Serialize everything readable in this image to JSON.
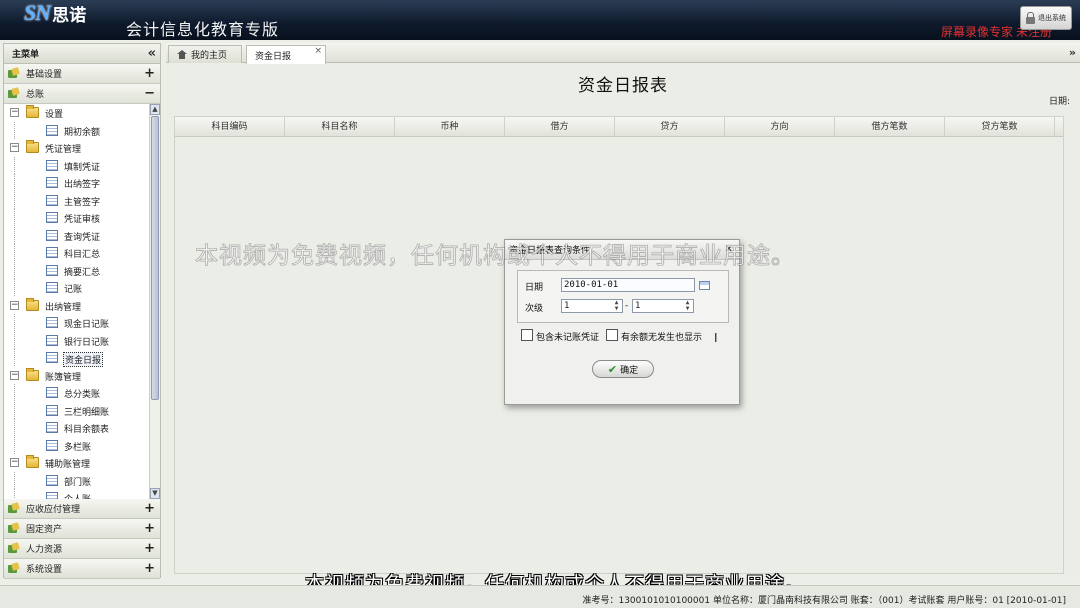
{
  "header": {
    "logo_text": "SN",
    "logo_cn": "思诺",
    "app_title": "会计信息化教育专版",
    "logout_label": "退出系统",
    "recorder_mark": "屏幕录像专家 未注册"
  },
  "sidebar": {
    "title": "主菜单",
    "groups_top": [
      {
        "label": "基础设置",
        "toggle": "+"
      },
      {
        "label": "总账",
        "toggle": "−"
      }
    ],
    "tree": [
      {
        "type": "folder",
        "label": "设置",
        "toggle": "−"
      },
      {
        "type": "leaf",
        "label": "期初余额"
      },
      {
        "type": "folder",
        "label": "凭证管理",
        "toggle": "−"
      },
      {
        "type": "leaf",
        "label": "填制凭证"
      },
      {
        "type": "leaf",
        "label": "出纳签字"
      },
      {
        "type": "leaf",
        "label": "主管签字"
      },
      {
        "type": "leaf",
        "label": "凭证审核"
      },
      {
        "type": "leaf",
        "label": "查询凭证"
      },
      {
        "type": "leaf",
        "label": "科目汇总"
      },
      {
        "type": "leaf",
        "label": "摘要汇总"
      },
      {
        "type": "leaf",
        "label": "记账"
      },
      {
        "type": "folder",
        "label": "出纳管理",
        "toggle": "−"
      },
      {
        "type": "leaf",
        "label": "现金日记账"
      },
      {
        "type": "leaf",
        "label": "银行日记账"
      },
      {
        "type": "leaf",
        "label": "资金日报",
        "selected": true
      },
      {
        "type": "folder",
        "label": "账簿管理",
        "toggle": "−"
      },
      {
        "type": "leaf",
        "label": "总分类账"
      },
      {
        "type": "leaf",
        "label": "三栏明细账"
      },
      {
        "type": "leaf",
        "label": "科目余额表"
      },
      {
        "type": "leaf",
        "label": "多栏账"
      },
      {
        "type": "folder",
        "label": "辅助账管理",
        "toggle": "−"
      },
      {
        "type": "leaf",
        "label": "部门账"
      },
      {
        "type": "leaf",
        "label": "个人账"
      }
    ],
    "groups_bottom": [
      {
        "label": "应收应付管理",
        "toggle": "+"
      },
      {
        "label": "固定资产",
        "toggle": "+"
      },
      {
        "label": "人力资源",
        "toggle": "+"
      },
      {
        "label": "系统设置",
        "toggle": "+"
      }
    ]
  },
  "tabs": {
    "home": "我的主页",
    "active": "资金日报"
  },
  "report": {
    "title": "资金日报表",
    "date_label": "日期:",
    "columns": [
      "科目编码",
      "科目名称",
      "币种",
      "借方",
      "贷方",
      "方向",
      "借方笔数",
      "贷方笔数"
    ]
  },
  "dialog": {
    "title": "资金日报表查询条件",
    "date_label": "日期",
    "date_value": "2010-01-01",
    "level_label": "次级",
    "level_from": "1",
    "level_to": "1",
    "include_unposted": "包含未记账凭证",
    "show_no_activity": "有余额无发生也显示",
    "ok_label": "确定"
  },
  "watermark": "本视频为免费视频，任何机构或个人不得用于商业用途。",
  "status_bar": "准考号：13001010101000​01   单位名称：厦门晶南科技有限公司   账套：（001）考试账套   用户账号：01    [2010-01-01]"
}
